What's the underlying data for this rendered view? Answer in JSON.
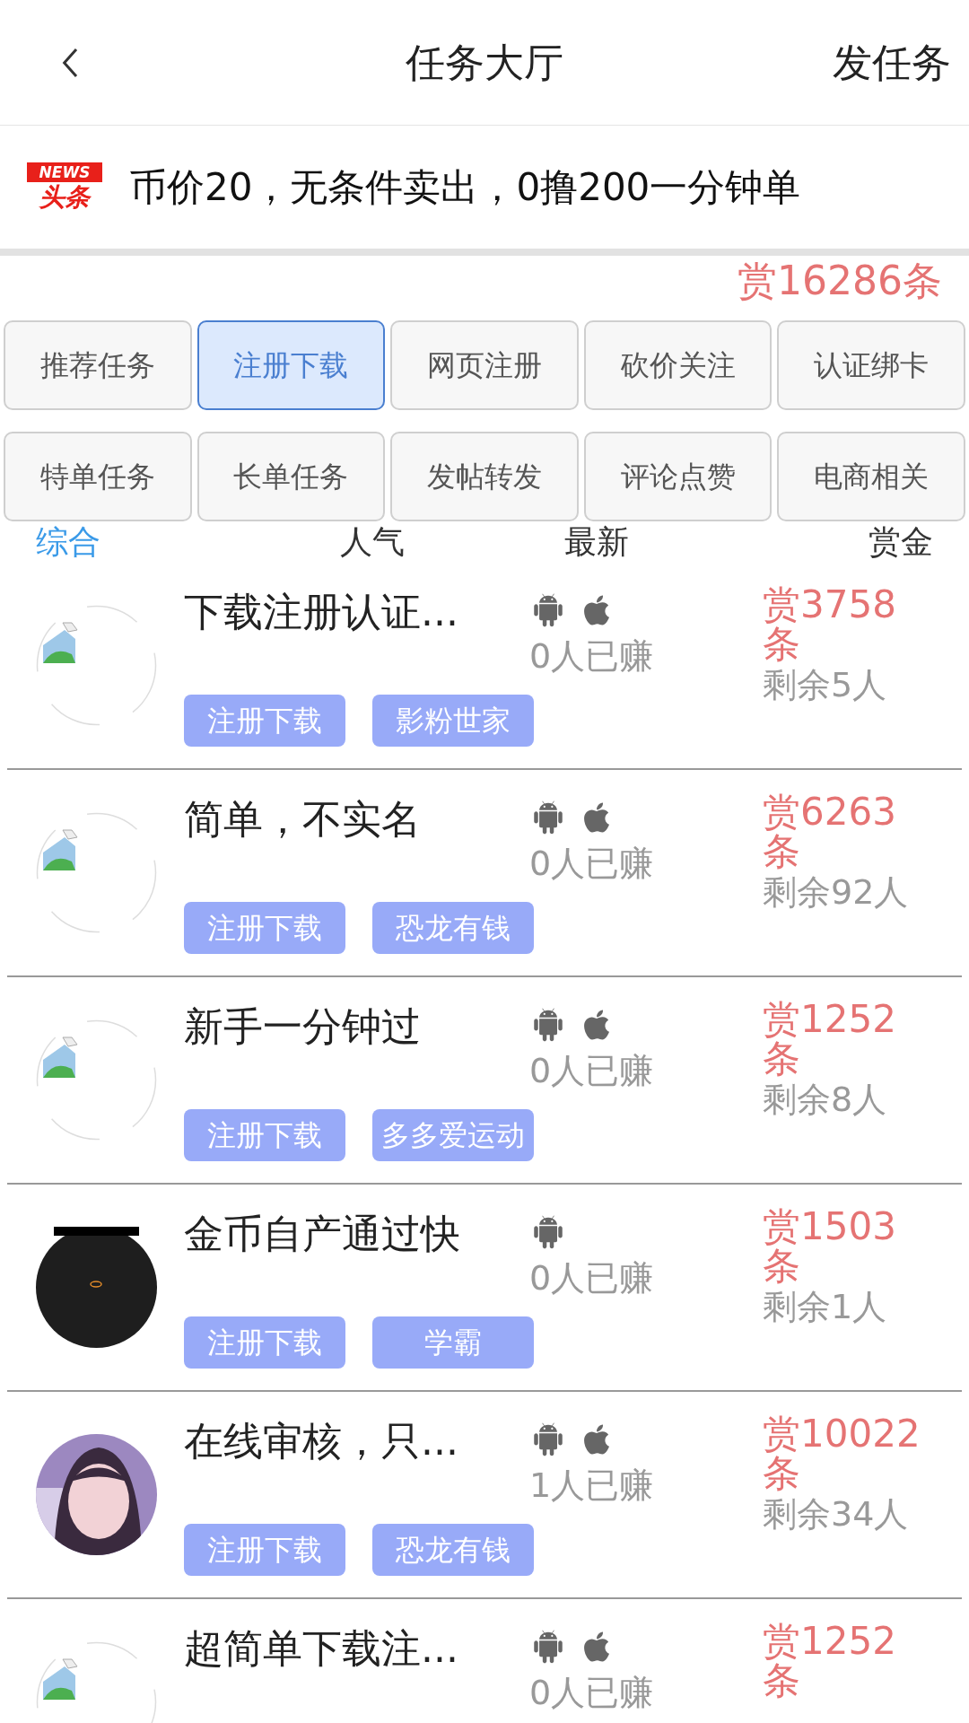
{
  "header": {
    "title": "任务大厅",
    "action": "发任务"
  },
  "news": {
    "logo_top": "NEWS",
    "logo_bottom": "头条",
    "text": "币价20，无条件卖出，0撸200一分钟单",
    "reward": "赏16286条"
  },
  "categories": [
    {
      "label": "推荐任务",
      "selected": false
    },
    {
      "label": "注册下载",
      "selected": true
    },
    {
      "label": "网页注册",
      "selected": false
    },
    {
      "label": "砍价关注",
      "selected": false
    },
    {
      "label": "认证绑卡",
      "selected": false
    },
    {
      "label": "特单任务",
      "selected": false
    },
    {
      "label": "长单任务",
      "selected": false
    },
    {
      "label": "发帖转发",
      "selected": false
    },
    {
      "label": "评论点赞",
      "selected": false
    },
    {
      "label": "电商相关",
      "selected": false
    }
  ],
  "sort": [
    {
      "label": "综合",
      "selected": true
    },
    {
      "label": "人气",
      "selected": false
    },
    {
      "label": "最新",
      "selected": false
    },
    {
      "label": "赏金",
      "selected": false
    }
  ],
  "tasks": [
    {
      "avatar": {
        "kind": "broken"
      },
      "title": "下载注册认证...",
      "platforms": [
        {
          "kind": "android"
        },
        {
          "kind": "ios"
        }
      ],
      "earned": "0人已赚",
      "tags": [
        "注册下载",
        "影粉世家"
      ],
      "reward": "赏3758条",
      "remaining": "剩余5人"
    },
    {
      "avatar": {
        "kind": "broken"
      },
      "title": "简单，不实名",
      "platforms": [
        {
          "kind": "android"
        },
        {
          "kind": "ios"
        }
      ],
      "earned": "0人已赚",
      "tags": [
        "注册下载",
        "恐龙有钱"
      ],
      "reward": "赏6263条",
      "remaining": "剩余92人"
    },
    {
      "avatar": {
        "kind": "broken"
      },
      "title": "新手一分钟过",
      "platforms": [
        {
          "kind": "android"
        },
        {
          "kind": "ios"
        }
      ],
      "earned": "0人已赚",
      "tags": [
        "注册下载",
        "多多爱运动"
      ],
      "reward": "赏1252条",
      "remaining": "剩余8人"
    },
    {
      "avatar": {
        "kind": "dark"
      },
      "title": "金币自产通过快",
      "platforms": [
        {
          "kind": "android"
        }
      ],
      "earned": "0人已赚",
      "tags": [
        "注册下载",
        "学霸"
      ],
      "reward": "赏1503条",
      "remaining": "剩余1人"
    },
    {
      "title": "在线审核，只...",
      "platforms": [
        {
          "kind": "android"
        },
        {
          "kind": "ios"
        }
      ],
      "earned": "1人已赚",
      "tags": [
        "注册下载",
        "恐龙有钱"
      ],
      "reward": "赏10022条",
      "remaining": "剩余34人"
    },
    {
      "avatar": {
        "kind": "broken"
      },
      "title": "超简单下载注...",
      "platforms": [
        {
          "kind": "android"
        },
        {
          "kind": "ios"
        }
      ],
      "earned": "0人已赚",
      "reward": "赏1252条"
    }
  ]
}
